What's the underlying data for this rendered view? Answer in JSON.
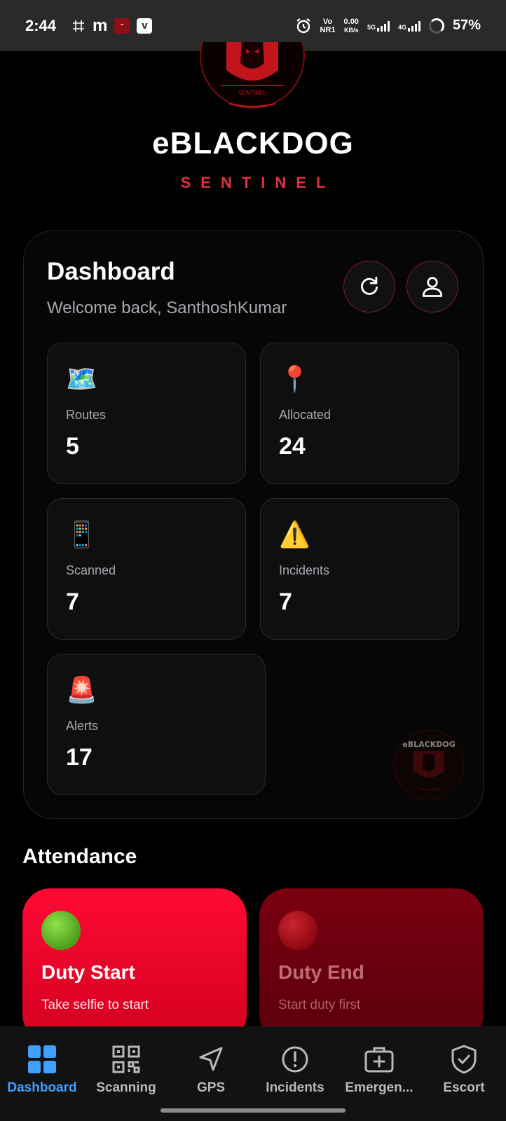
{
  "status_bar": {
    "time": "2:44",
    "app_icon_m": "m",
    "app_icon_v": "v",
    "volte_top": "Vo",
    "volte_bottom": "NR1",
    "speed_top": "0.00",
    "speed_bottom": "KB/s",
    "net_5g": "5G",
    "net_4g": "4G",
    "battery_pct": "57%"
  },
  "brand": {
    "title": "eBLACKDOG",
    "subtitle": "SENTINEL",
    "logo_text": "SENTINEL"
  },
  "dashboard": {
    "title": "Dashboard",
    "welcome": "Welcome back, SanthoshKumar",
    "watermark_text": "eBLACKDOG",
    "stats": {
      "routes": {
        "icon": "🗺️",
        "label": "Routes",
        "value": "5"
      },
      "allocated": {
        "icon": "📍",
        "label": "Allocated",
        "value": "24"
      },
      "scanned": {
        "icon": "📱",
        "label": "Scanned",
        "value": "7"
      },
      "incidents": {
        "icon": "⚠️",
        "label": "Incidents",
        "value": "7"
      },
      "alerts": {
        "icon": "🚨",
        "label": "Alerts",
        "value": "17"
      }
    }
  },
  "attendance": {
    "title": "Attendance",
    "start": {
      "title": "Duty Start",
      "subtitle": "Take selfie to start"
    },
    "end": {
      "title": "Duty End",
      "subtitle": "Start duty first"
    }
  },
  "nav": {
    "dashboard": "Dashboard",
    "scanning": "Scanning",
    "gps": "GPS",
    "incidents": "Incidents",
    "emergency": "Emergen...",
    "escort": "Escort"
  },
  "colors": {
    "accent_red": "#e0313c",
    "active_blue": "#3fa0ff",
    "duty_start": "#ff0a34",
    "duty_end": "#7a0010"
  }
}
